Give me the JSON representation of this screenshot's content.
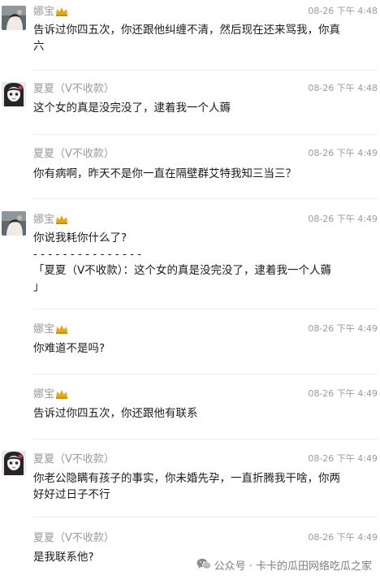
{
  "messages": [
    {
      "sender": "娜宝",
      "time": "08-26 下午 4:48",
      "lines": [
        "告诉过你四五次，你还跟他纠缠不清，然后现在还来骂我，你真",
        "六"
      ]
    },
    {
      "sender": "夏夏（V不收款）",
      "time": "08-26 下午 4:48",
      "lines": [
        "这个女的真是没完没了，逮着我一个人薅"
      ]
    },
    {
      "sender": "夏夏（V不收款）",
      "time": "08-26 下午 4:49",
      "lines": [
        "你有病啊，昨天不是你一直在隔壁群艾特我知三当三？"
      ]
    },
    {
      "sender": "娜宝",
      "time": "08-26 下午 4:49",
      "lines": [
        "你说我耗你什么了?",
        "- - - - - - - - - - - - - - -",
        "「夏夏（V不收款）：这个女的真是没完没了，逮着我一个人薅",
        "」"
      ]
    },
    {
      "sender": "娜宝",
      "time": "08-26 下午 4:49",
      "lines": [
        "你难道不是吗?"
      ]
    },
    {
      "sender": "娜宝",
      "time": "08-26 下午 4:49",
      "lines": [
        "告诉过你四五次，你还跟他有联系"
      ]
    },
    {
      "sender": "夏夏（V不收款）",
      "time": "08-26 下午 4:49",
      "lines": [
        "你老公隐瞒有孩子的事实，你未婚先孕，一直折腾我干啥，你两",
        "好好过日子不行"
      ]
    },
    {
      "sender": "夏夏（V不收款）",
      "time": "08-26 下午 4:49",
      "lines": [
        "是我联系他?"
      ]
    }
  ],
  "watermark": {
    "text": "公众号 · 卡卡的瓜田网络吃瓜之家",
    "icon": "wechat-icon"
  },
  "icons": {
    "crown": "crown-icon",
    "avatar_na": "avatar-na-bao",
    "avatar_xia": "avatar-xia-xia"
  },
  "colors": {
    "meta_gray": "#9a9a9a",
    "text": "#1a1a1a",
    "separator": "#ececec",
    "crown_gold": "#e0a81c"
  }
}
